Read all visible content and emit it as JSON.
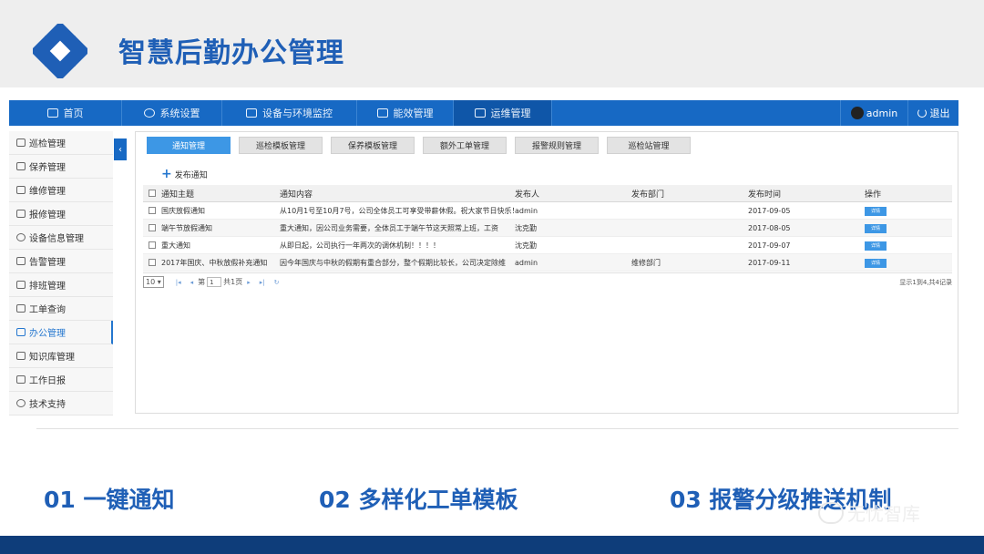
{
  "slide": {
    "title": "智慧后勤办公管理",
    "features": [
      "01 一键通知",
      "02 多样化工单模板",
      "03 报警分级推送机制"
    ],
    "watermark": "无忧智库"
  },
  "topnav": {
    "items": [
      {
        "label": "首页",
        "icon": "home-icon"
      },
      {
        "label": "系统设置",
        "icon": "gear-icon"
      },
      {
        "label": "设备与环境监控",
        "icon": "monitor-icon"
      },
      {
        "label": "能效管理",
        "icon": "document-icon"
      },
      {
        "label": "运维管理",
        "icon": "tools-icon",
        "active": true
      }
    ],
    "user": "admin",
    "logout": "退出"
  },
  "sidebar": {
    "items": [
      {
        "label": "巡检管理"
      },
      {
        "label": "保养管理"
      },
      {
        "label": "维修管理"
      },
      {
        "label": "报修管理"
      },
      {
        "label": "设备信息管理"
      },
      {
        "label": "告警管理"
      },
      {
        "label": "排班管理"
      },
      {
        "label": "工单查询"
      },
      {
        "label": "办公管理",
        "active": true
      },
      {
        "label": "知识库管理"
      },
      {
        "label": "工作日报"
      },
      {
        "label": "技术支持"
      }
    ]
  },
  "tabs": [
    "通知管理",
    "巡检模板管理",
    "保养模板管理",
    "额外工单管理",
    "报警规则管理",
    "巡检站管理"
  ],
  "toolbar": {
    "publish": "发布通知"
  },
  "table": {
    "headers": [
      "通知主题",
      "通知内容",
      "发布人",
      "发布部门",
      "发布时间",
      "操作"
    ],
    "rows": [
      {
        "title": "国庆放假通知",
        "content": "从10月1号至10月7号，公司全体员工可享受带薪休假。祝大家节日快乐！",
        "publisher": "admin",
        "dept": "",
        "time": "2017-09-05",
        "op": "详情"
      },
      {
        "title": "端午节放假通知",
        "content": "重大通知，因公司业务需要，全体员工于端午节这天照常上班，工资",
        "publisher": "沈克勤",
        "dept": "",
        "time": "2017-08-05",
        "op": "详情"
      },
      {
        "title": "重大通知",
        "content": "从即日起，公司执行一年两次的调休机制！！！！",
        "publisher": "沈克勤",
        "dept": "",
        "time": "2017-09-07",
        "op": "详情"
      },
      {
        "title": "2017年国庆、中秋放假补充通知",
        "content": "因今年国庆与中秋的假期有重合部分，整个假期比较长，公司决定除维",
        "publisher": "admin",
        "dept": "维修部门",
        "time": "2017-09-11",
        "op": "详情"
      }
    ]
  },
  "pager": {
    "page_size": "10",
    "page_label": "第",
    "page_value": "1",
    "total_pages": "共1页",
    "info": "显示1到4,共4记录"
  }
}
